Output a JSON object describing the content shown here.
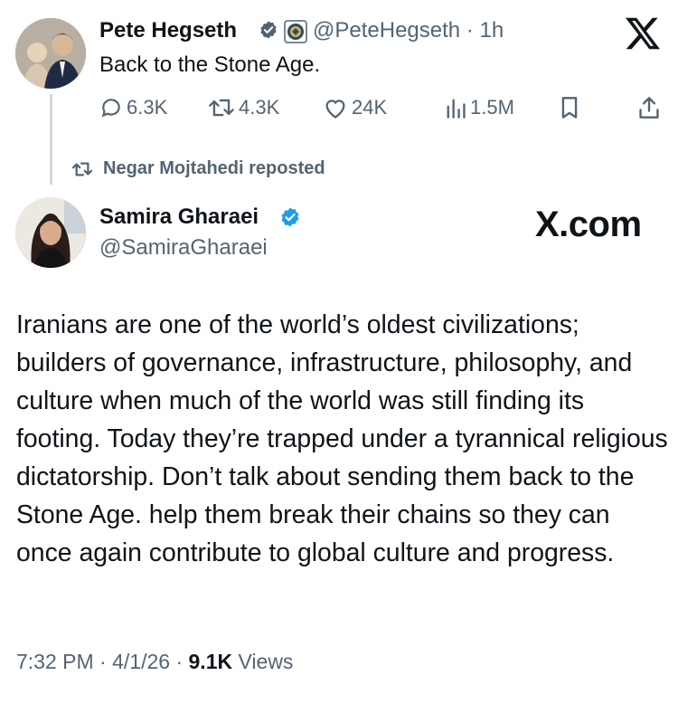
{
  "top_tweet": {
    "name": "Pete Hegseth",
    "handle": "@PeteHegseth",
    "separator": "·",
    "time": "1h",
    "text": "Back to the Stone Age.",
    "verified_icon": "verified-badge-icon",
    "affiliate_icon": "government-seal-icon",
    "actions": {
      "replies": "6.3K",
      "reposts": "4.3K",
      "likes": "24K",
      "views": "1.5M"
    }
  },
  "repost": {
    "label": "Negar Mojtahedi reposted"
  },
  "main_tweet": {
    "name": "Samira Gharaei",
    "handle": "@SamiraGharaei",
    "text": "Iranians are one of the world’s oldest civilizations; builders of governance, infrastructure, philosophy, and culture when much of the world was still finding its footing. Today they’re trapped under a tyrannical religious dictatorship. Don’t talk about sending them back to the Stone Age. help them break their chains so they can once again contribute to global culture and progress.",
    "time": "7:32 PM",
    "date": "4/1/26",
    "separator": "·",
    "views_count": "9.1K",
    "views_label": "Views"
  },
  "branding": {
    "xcom_label": "X.com"
  },
  "colors": {
    "text_primary": "#0f1419",
    "text_secondary": "#536471",
    "verified_blue": "#1d9bf0",
    "thread_line": "#cfd9de"
  }
}
